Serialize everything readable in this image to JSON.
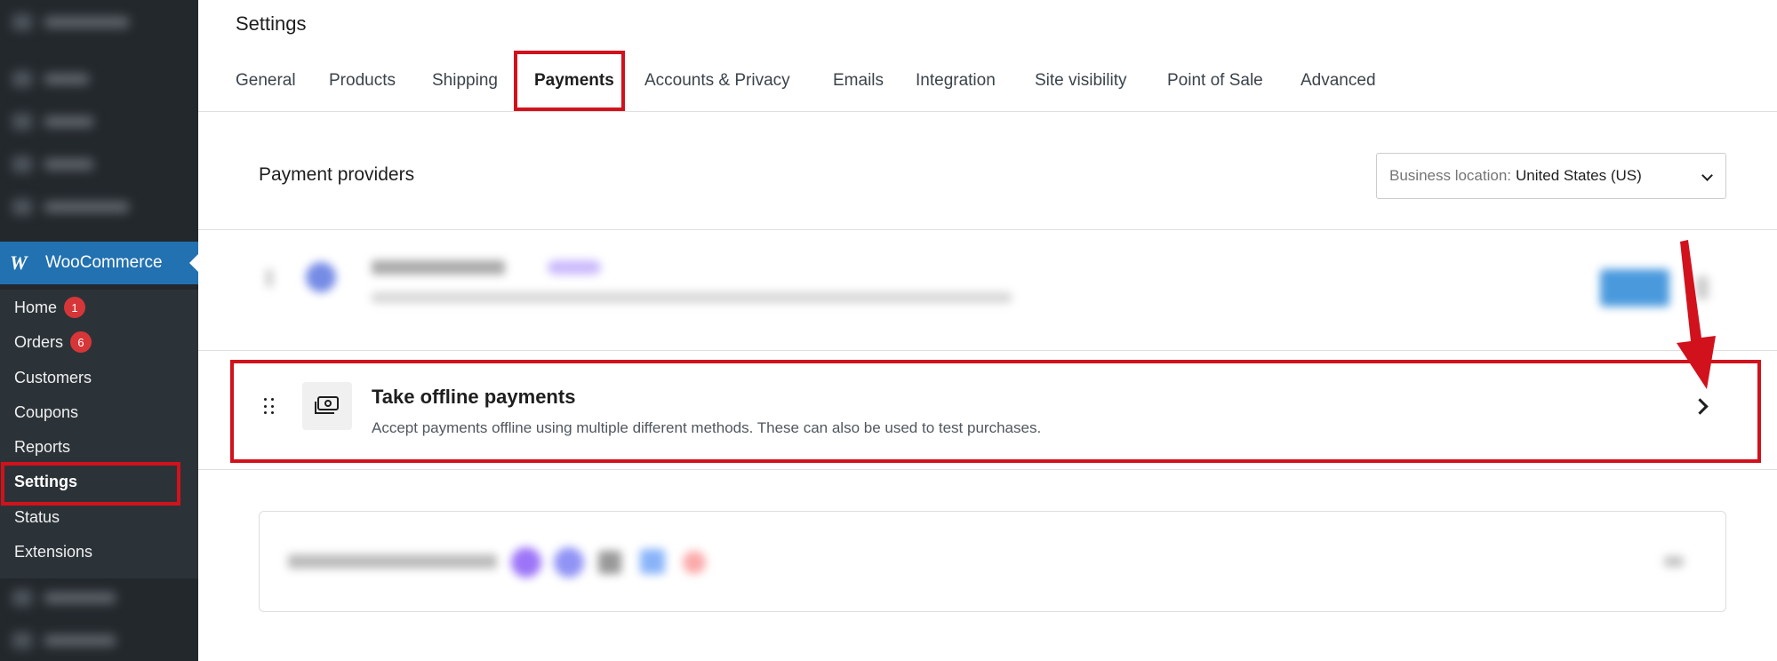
{
  "header": {
    "title": "Settings"
  },
  "tabs": [
    {
      "label": "General"
    },
    {
      "label": "Products"
    },
    {
      "label": "Shipping"
    },
    {
      "label": "Payments"
    },
    {
      "label": "Accounts & Privacy"
    },
    {
      "label": "Emails"
    },
    {
      "label": "Integration"
    },
    {
      "label": "Site visibility"
    },
    {
      "label": "Point of Sale"
    },
    {
      "label": "Advanced"
    }
  ],
  "active_tab": "Payments",
  "sidebar": {
    "brand": "WooCommerce",
    "items": [
      {
        "label": "Home",
        "badge": "1"
      },
      {
        "label": "Orders",
        "badge": "6"
      },
      {
        "label": "Customers"
      },
      {
        "label": "Coupons"
      },
      {
        "label": "Reports"
      },
      {
        "label": "Settings"
      },
      {
        "label": "Status"
      },
      {
        "label": "Extensions"
      }
    ],
    "active_item": "Settings"
  },
  "payments": {
    "section_title": "Payment providers",
    "business_location_label": "Business location:",
    "business_location_value": "United States (US)",
    "offline": {
      "title": "Take offline payments",
      "description": "Accept payments offline using multiple different methods. These can also be used to test purchases."
    }
  },
  "colors": {
    "sidebar_bg": "#23282d",
    "submenu_bg": "#2c3338",
    "woo_blue": "#2271b1",
    "badge_red": "#d63638",
    "annotation_red": "#d1121c"
  },
  "icons": {
    "woo_logo": "woocommerce-logo-icon",
    "drag": "drag-handle-icon",
    "offline": "cash-icon",
    "chevron": "chevron-right-icon",
    "select": "chevron-down-icon"
  }
}
